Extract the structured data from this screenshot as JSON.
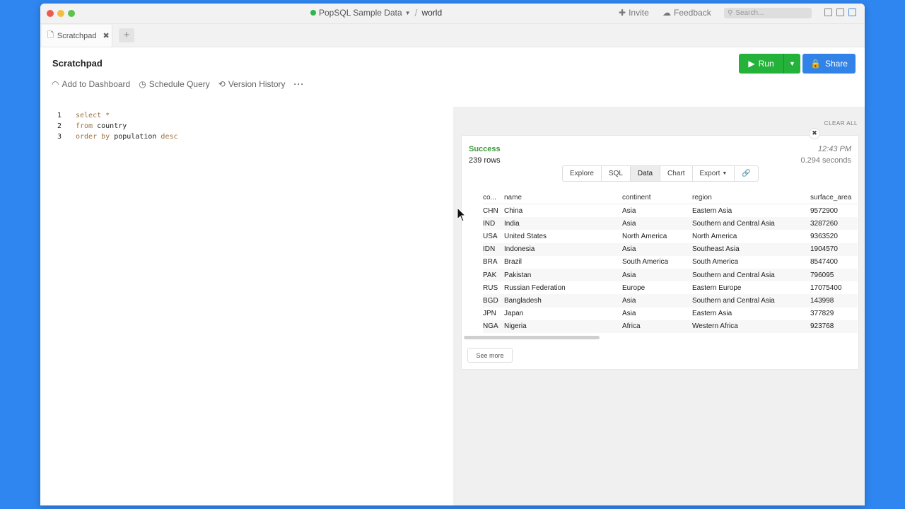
{
  "titlebar": {
    "connection": "PopSQL Sample Data",
    "database": "world",
    "invite": "Invite",
    "feedback": "Feedback",
    "search_placeholder": "Search..."
  },
  "tabs": [
    {
      "label": "Scratchpad"
    }
  ],
  "header": {
    "title": "Scratchpad",
    "actions": [
      "Add to Dashboard",
      "Schedule Query",
      "Version History"
    ],
    "run_label": "Run",
    "share_label": "Share"
  },
  "editor": {
    "lines": [
      {
        "n": "1",
        "parts": [
          [
            "kw",
            "select *"
          ]
        ]
      },
      {
        "n": "2",
        "parts": [
          [
            "kw",
            "from "
          ],
          [
            "id",
            "country"
          ]
        ]
      },
      {
        "n": "3",
        "parts": [
          [
            "kw",
            "order by "
          ],
          [
            "id",
            "population"
          ],
          [
            "kw",
            " desc"
          ]
        ]
      }
    ]
  },
  "results": {
    "clear_all": "CLEAR ALL",
    "status": "Success",
    "rows": "239 rows",
    "time": "12:43 PM",
    "duration": "0.294 seconds",
    "tabs": [
      "Explore",
      "SQL",
      "Data",
      "Chart",
      "Export"
    ],
    "active_tab": "Data",
    "columns": [
      "co...",
      "name",
      "continent",
      "region",
      "surface_area"
    ],
    "data": [
      [
        "CHN",
        "China",
        "Asia",
        "Eastern Asia",
        "9572900"
      ],
      [
        "IND",
        "India",
        "Asia",
        "Southern and Central Asia",
        "3287260"
      ],
      [
        "USA",
        "United States",
        "North America",
        "North America",
        "9363520"
      ],
      [
        "IDN",
        "Indonesia",
        "Asia",
        "Southeast Asia",
        "1904570"
      ],
      [
        "BRA",
        "Brazil",
        "South America",
        "South America",
        "8547400"
      ],
      [
        "PAK",
        "Pakistan",
        "Asia",
        "Southern and Central Asia",
        "796095"
      ],
      [
        "RUS",
        "Russian Federation",
        "Europe",
        "Eastern Europe",
        "17075400"
      ],
      [
        "BGD",
        "Bangladesh",
        "Asia",
        "Southern and Central Asia",
        "143998"
      ],
      [
        "JPN",
        "Japan",
        "Asia",
        "Eastern Asia",
        "377829"
      ],
      [
        "NGA",
        "Nigeria",
        "Africa",
        "Western Africa",
        "923768"
      ]
    ],
    "see_more": "See more"
  },
  "colors": {
    "run": "#24b23a",
    "share": "#3183e8",
    "success": "#3b9a3b",
    "background": "#2f86f0"
  }
}
